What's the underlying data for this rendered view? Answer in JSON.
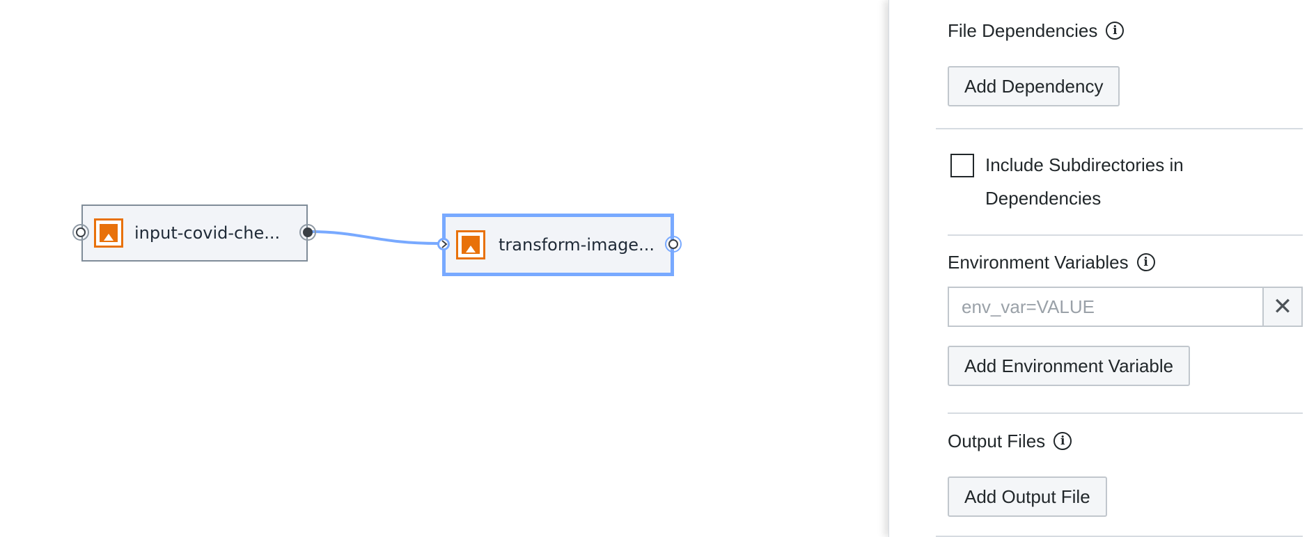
{
  "canvas": {
    "nodes": [
      {
        "label": "input-covid-che...",
        "icon": "notebook-icon",
        "color": "#e8710a",
        "selected": false
      },
      {
        "label": "transform-image...",
        "icon": "notebook-icon",
        "color": "#e8710a",
        "selected": true
      }
    ],
    "edge_color": "#78a9ff"
  },
  "panel": {
    "file_dependencies": {
      "title": "File Dependencies",
      "info_icon": "info-icon",
      "add_label": "Add Dependency"
    },
    "include_subdirectories": {
      "label_line1": "Include Subdirectories in",
      "label_line2": "Dependencies",
      "checked": false
    },
    "environment_variables": {
      "title": "Environment Variables",
      "info_icon": "info-icon",
      "input_placeholder": "env_var=VALUE",
      "input_value": "",
      "clear_icon": "close-icon",
      "add_label": "Add Environment Variable"
    },
    "output_files": {
      "title": "Output Files",
      "info_icon": "info-icon",
      "add_label": "Add Output File"
    }
  }
}
